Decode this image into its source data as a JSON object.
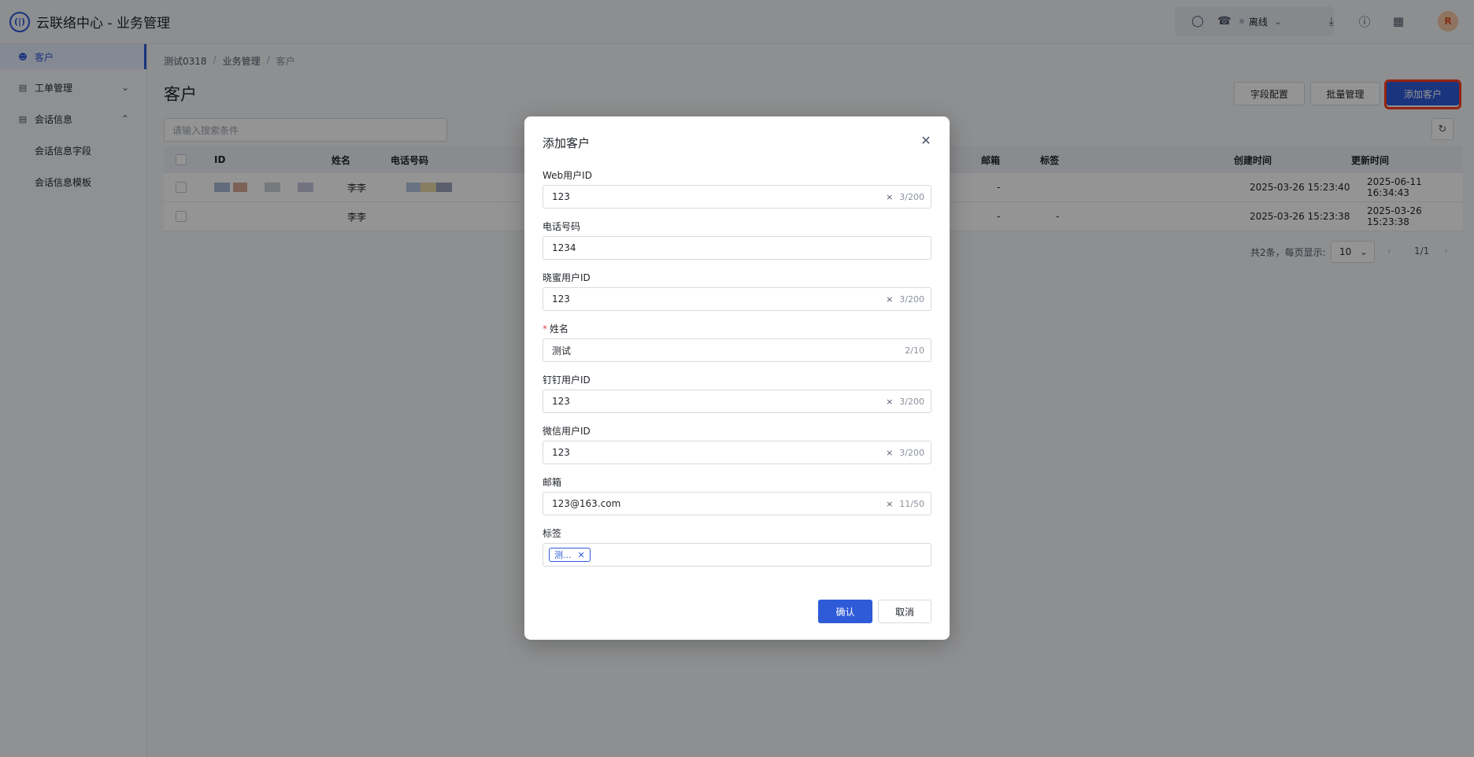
{
  "app": {
    "logo_text": "(|)",
    "title": "云联络中心 - 业务管理"
  },
  "topbar": {
    "status": "离线",
    "avatar_text": "R"
  },
  "sidebar": {
    "items": [
      {
        "label": "客户"
      },
      {
        "label": "工单管理"
      },
      {
        "label": "会话信息"
      }
    ],
    "sub_items": [
      {
        "label": "会话信息字段"
      },
      {
        "label": "会话信息模板"
      }
    ]
  },
  "breadcrumb": [
    "测试0318",
    "业务管理",
    "客户"
  ],
  "page": {
    "title": "客户",
    "buttons": {
      "field_config": "字段配置",
      "batch": "批量管理",
      "add": "添加客户"
    },
    "search_placeholder": "请输入搜索条件"
  },
  "table": {
    "headers": {
      "id": "ID",
      "name": "姓名",
      "phone": "电话号码",
      "email": "邮箱",
      "tags": "标签",
      "created": "创建时间",
      "updated": "更新时间"
    },
    "rows": [
      {
        "name": "李李",
        "email": "-",
        "tags": "",
        "created": "2025-03-26 15:23:40",
        "updated": "2025-06-11 16:34:43"
      },
      {
        "name": "李李",
        "email": "-",
        "tags": "-",
        "created": "2025-03-26 15:23:38",
        "updated": "2025-03-26 15:23:38"
      }
    ]
  },
  "pager": {
    "total": "共2条，每页显示:",
    "page_size": "10",
    "page": "1/1"
  },
  "modal": {
    "title": "添加客户",
    "fields": {
      "web_id": {
        "label": "Web用户ID",
        "value": "123",
        "count": "3/200"
      },
      "phone": {
        "label": "电话号码",
        "value": "1234"
      },
      "xiaomi_id": {
        "label": "晓蜜用户ID",
        "value": "123",
        "count": "3/200"
      },
      "name": {
        "required": "*",
        "label": "姓名",
        "value": "测试",
        "count": "2/10"
      },
      "dingtalk_id": {
        "label": "钉钉用户ID",
        "value": "123",
        "count": "3/200"
      },
      "wechat_id": {
        "label": "微信用户ID",
        "value": "123",
        "count": "3/200"
      },
      "email": {
        "label": "邮箱",
        "value": "123@163.com",
        "count": "11/50"
      },
      "tags": {
        "label": "标签",
        "tag": "测..."
      }
    },
    "confirm": "确认",
    "cancel": "取消"
  },
  "colors": {
    "primary": "#2e5bd8",
    "highlight": "#ff3b1f",
    "overlay": "rgba(0,0,0,0.42)"
  }
}
